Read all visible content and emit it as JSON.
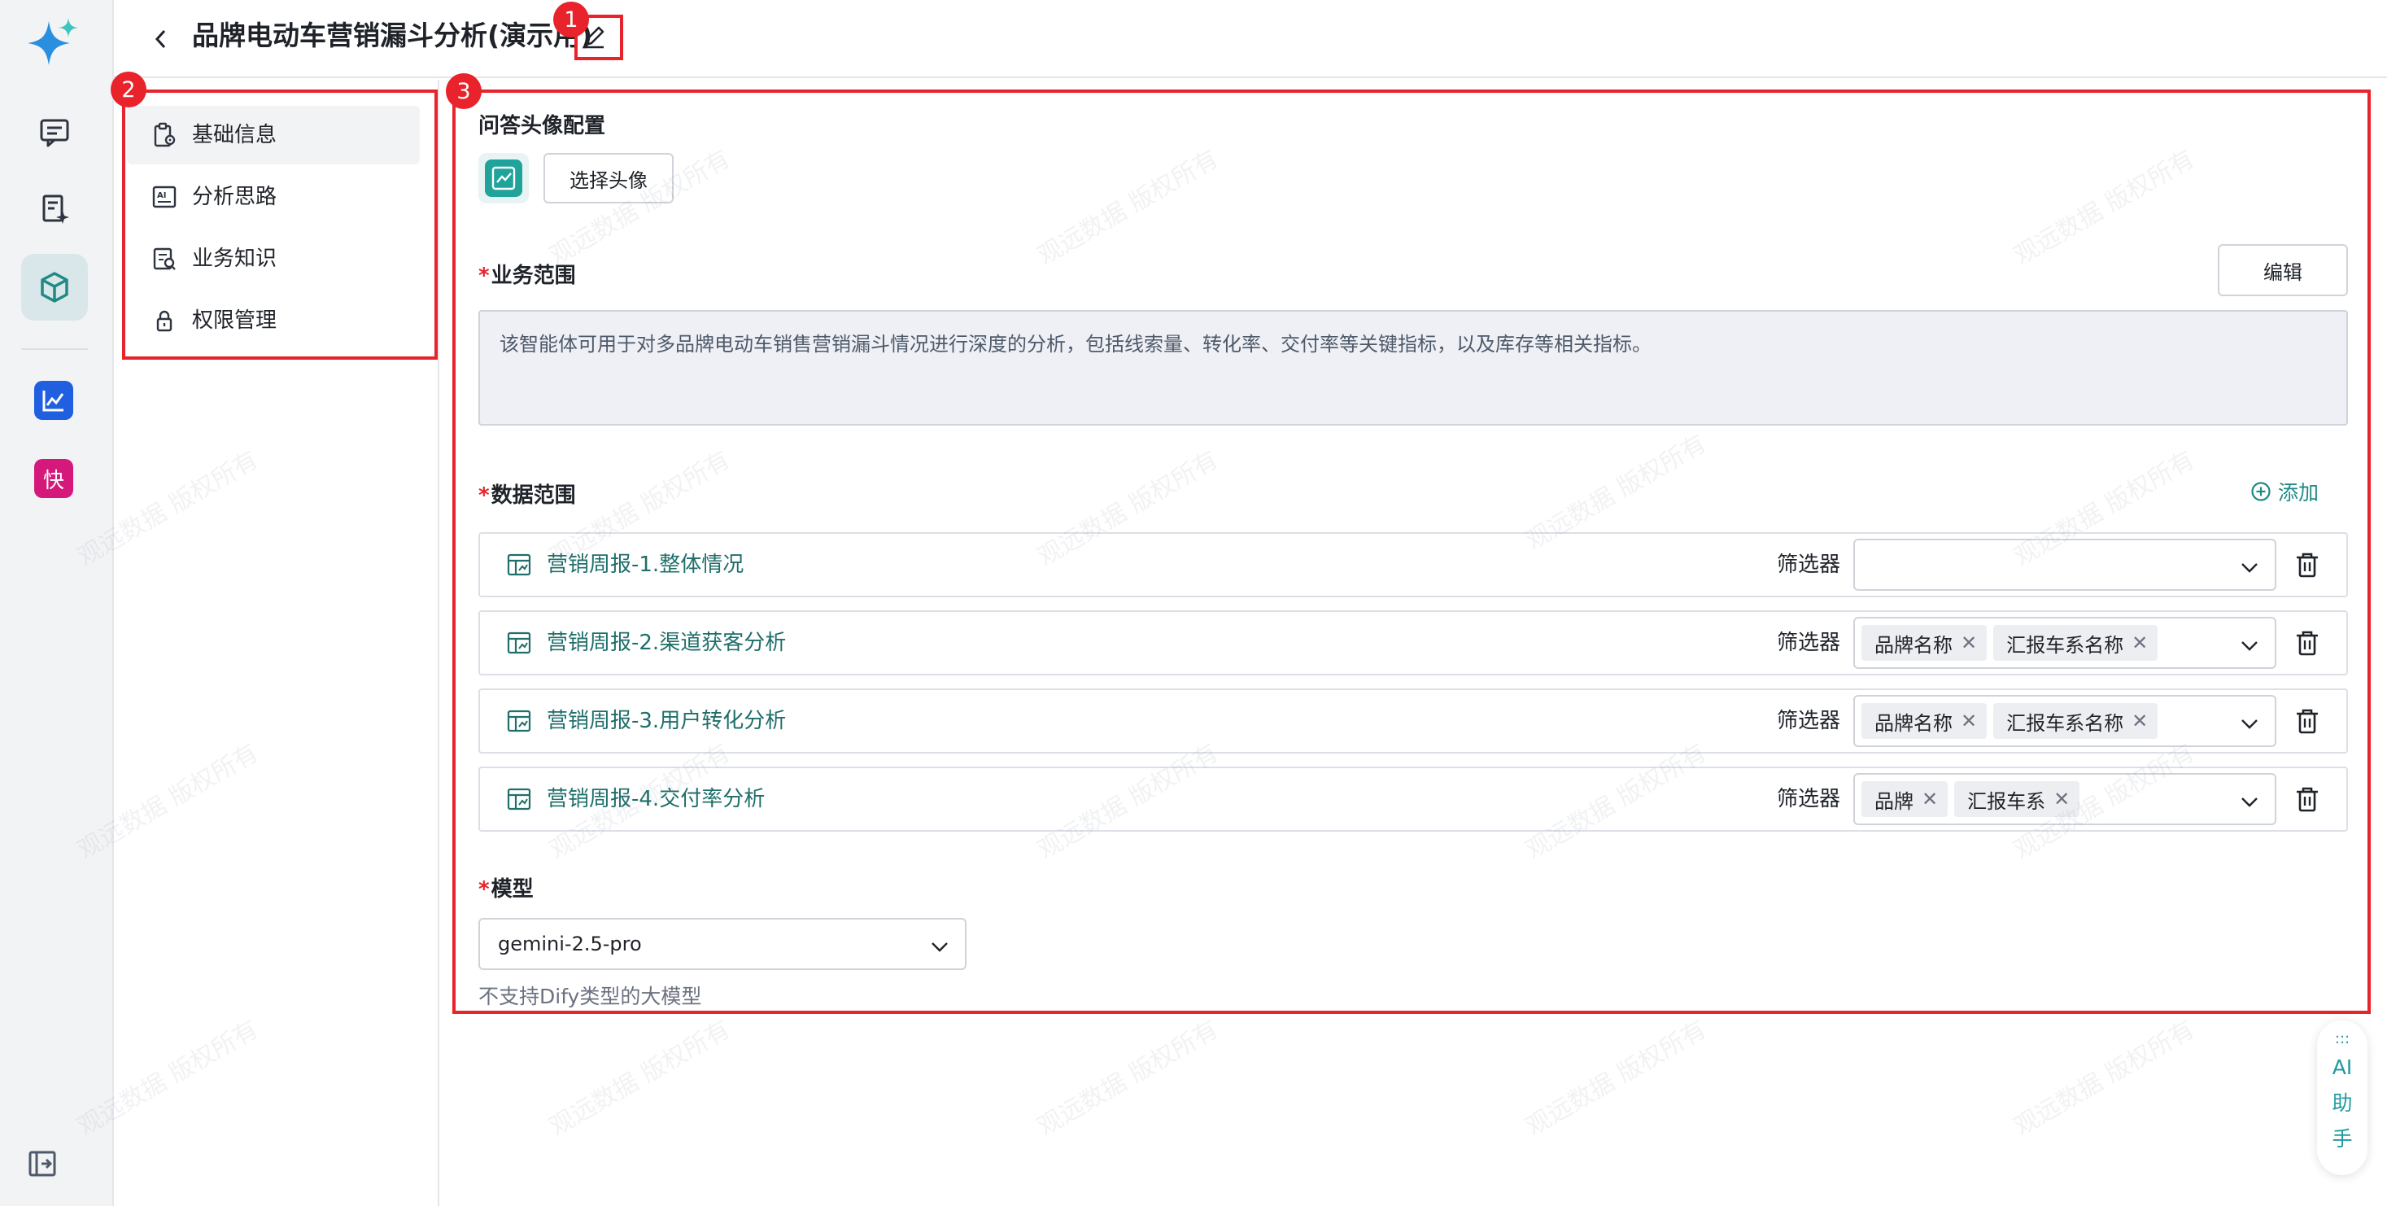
{
  "header": {
    "title": "品牌电动车营销漏斗分析(演示用)"
  },
  "annotations": [
    "1",
    "2",
    "3"
  ],
  "subnav": {
    "items": [
      {
        "label": "基础信息",
        "icon": "clipboard-gear-icon"
      },
      {
        "label": "分析思路",
        "icon": "ai-doc-icon"
      },
      {
        "label": "业务知识",
        "icon": "knowledge-icon"
      },
      {
        "label": "权限管理",
        "icon": "lock-icon"
      }
    ]
  },
  "avatar_config": {
    "label": "问答头像配置",
    "choose_button": "选择头像"
  },
  "business_scope": {
    "required_mark": "*",
    "label": "业务范围",
    "edit_button": "编辑",
    "text": "该智能体可用于对多品牌电动车销售营销漏斗情况进行深度的分析，包括线索量、转化率、交付率等关键指标，以及库存等相关指标。"
  },
  "data_scope": {
    "required_mark": "*",
    "label": "数据范围",
    "add_label": "添加",
    "filter_label": "筛选器",
    "rows": [
      {
        "name": "营销周报-1.整体情况",
        "tags": []
      },
      {
        "name": "营销周报-2.渠道获客分析",
        "tags": [
          "品牌名称",
          "汇报车系名称"
        ]
      },
      {
        "name": "营销周报-3.用户转化分析",
        "tags": [
          "品牌名称",
          "汇报车系名称"
        ]
      },
      {
        "name": "营销周报-4.交付率分析",
        "tags": [
          "品牌",
          "汇报车系"
        ]
      }
    ]
  },
  "model": {
    "required_mark": "*",
    "label": "模型",
    "value": "gemini-2.5-pro",
    "hint": "不支持Dify类型的大模型"
  },
  "ai_assistant": {
    "dots": ":::",
    "line1": "AI",
    "line2": "助",
    "line3": "手"
  },
  "watermark": "观远数据 版权所有",
  "colors": {
    "accent": "#1f8a84",
    "annotation": "#e8232b",
    "link": "#1f6f6a"
  }
}
